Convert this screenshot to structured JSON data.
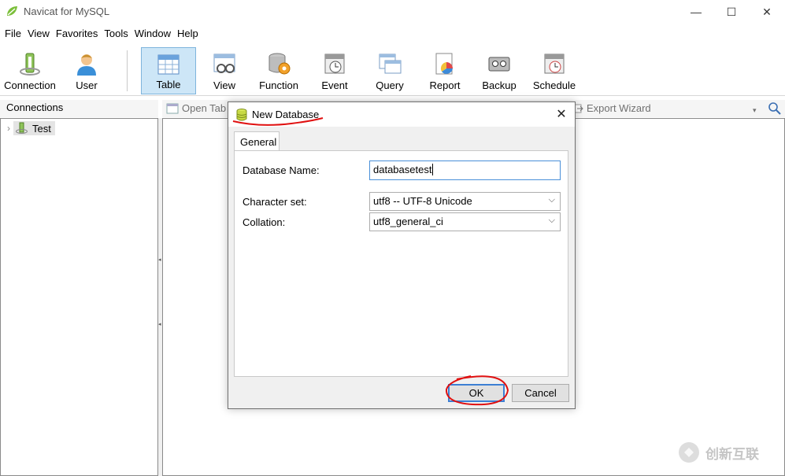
{
  "window": {
    "title": "Navicat for MySQL",
    "minimize": "—",
    "maximize": "☐",
    "close": "✕"
  },
  "menu": [
    "File",
    "View",
    "Favorites",
    "Tools",
    "Window",
    "Help"
  ],
  "toolbar": {
    "items": [
      "Connection",
      "User",
      "Table",
      "View",
      "Function",
      "Event",
      "Query",
      "Report",
      "Backup",
      "Schedule"
    ],
    "active": "Table"
  },
  "connections": {
    "header": "Connections",
    "tree": [
      {
        "label": "Test"
      }
    ]
  },
  "object_toolbar": {
    "open_table": "Open Tab",
    "export_wizard": "Export Wizard"
  },
  "dialog": {
    "title": "New Database",
    "tab": "General",
    "fields": {
      "database_name": {
        "label": "Database Name:",
        "value": "databasetest"
      },
      "character_set": {
        "label": "Character set:",
        "value": "utf8 -- UTF-8 Unicode"
      },
      "collation": {
        "label": "Collation:",
        "value": "utf8_general_ci"
      }
    },
    "ok_label": "OK",
    "cancel_label": "Cancel"
  },
  "watermark": {
    "text": "创新互联"
  },
  "colors": {
    "active_tool_bg": "#cde6f7",
    "annotation_red": "#e01010",
    "focus_blue": "#3c7fd4"
  }
}
